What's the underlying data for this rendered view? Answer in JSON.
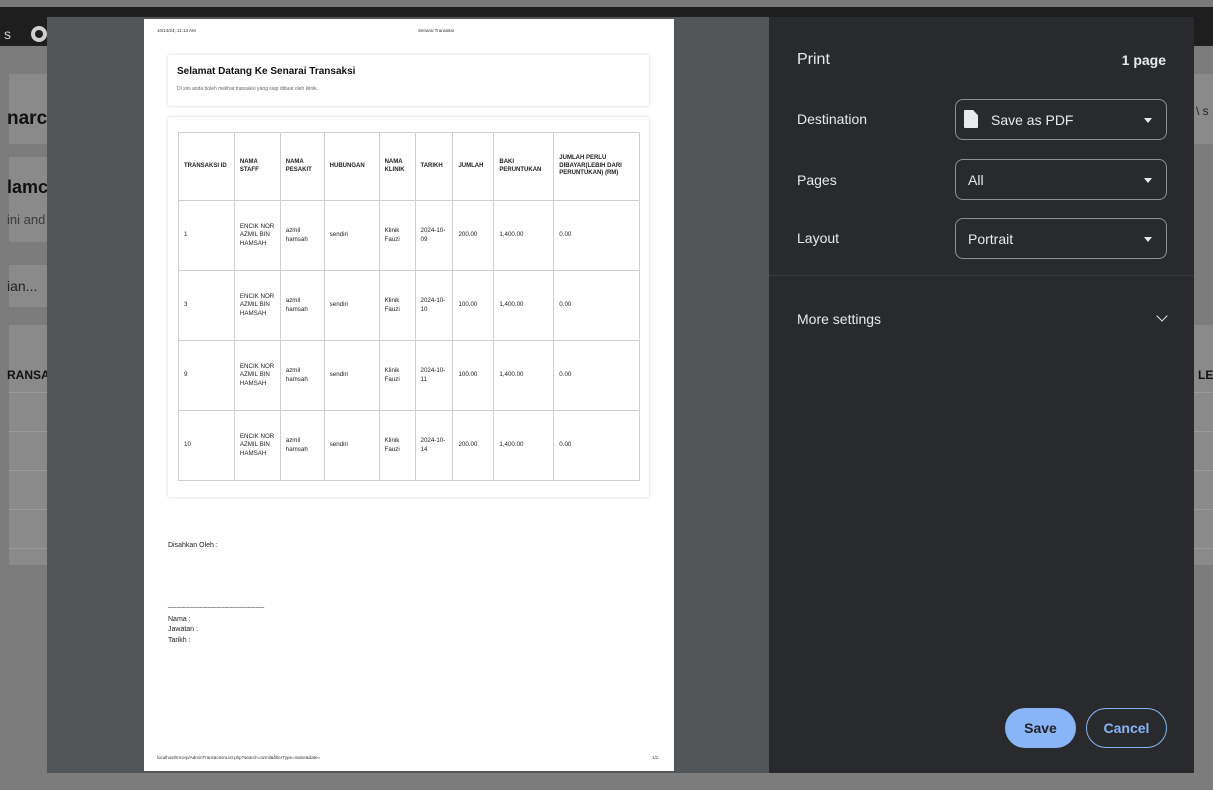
{
  "background_page": {
    "nav_text": "s",
    "title_fragment": "narc",
    "welcome_fragment": "lamc",
    "sub_fragment": "ini and",
    "search_fragment": "ian...",
    "col_fragment": "RANSA",
    "right_col_fragment": "LEBI",
    "right_edge_fragment": "\\ s"
  },
  "document": {
    "header_datetime": "10/14/24, 11:13 AM",
    "header_title": "Senarai Transaksi",
    "welcome_title": "Selamat Datang Ke Senarai Transaksi",
    "welcome_subtitle": "Di sini anda boleh melihat transaksi yang siap dibuat oleh klinik.",
    "table": {
      "headers": [
        "TRANSAKSI ID",
        "NAMA STAFF",
        "NAMA PESAKIT",
        "HUBUNGAN",
        "NAMA KLINIK",
        "TARIKH",
        "JUMLAH",
        "BAKI PERUNTUKAN",
        "JUMLAH PERLU DIBAYAR(LEBIH DARI PERUNTUKAN) (RM)"
      ],
      "rows": [
        [
          "1",
          "ENCIK NOR AZMIL BIN HAMSAH",
          "azmil hamsah",
          "sendiri",
          "Klinik Fauzi",
          "2024-10-09",
          "200.00",
          "1,400.00",
          "0.00"
        ],
        [
          "3",
          "ENCIK NOR AZMIL BIN HAMSAH",
          "azmil hamsah",
          "sendiri",
          "Klinik Fauzi",
          "2024-10-10",
          "100.00",
          "1,400.00",
          "0.00"
        ],
        [
          "9",
          "ENCIK NOR AZMIL BIN HAMSAH",
          "azmil hamsah",
          "sendiri",
          "Klinik Fauzi",
          "2024-10-11",
          "100.00",
          "1,400.00",
          "0.00"
        ],
        [
          "10",
          "ENCIK NOR AZMIL BIN HAMSAH",
          "azmil hamsah",
          "sendiri",
          "Klinik Fauzi",
          "2024-10-14",
          "200.00",
          "1,400.00",
          "0.00"
        ]
      ]
    },
    "approved_by": "Disahkan Oleh :",
    "signature_line": "______________________",
    "name_label": "Nama :",
    "position_label": "Jawatan :",
    "date_label": "Tarikh :",
    "footer_url": "localhost/mcorp/AdminTransactionList.php?search=azmil&filterType=name&date=",
    "footer_page": "1/1"
  },
  "print_panel": {
    "title": "Print",
    "page_count": "1 page",
    "destination_label": "Destination",
    "destination_value": "Save as PDF",
    "pages_label": "Pages",
    "pages_value": "All",
    "layout_label": "Layout",
    "layout_value": "Portrait",
    "more_settings_label": "More settings",
    "save_label": "Save",
    "cancel_label": "Cancel",
    "accent_color": "#8ab4f8"
  }
}
